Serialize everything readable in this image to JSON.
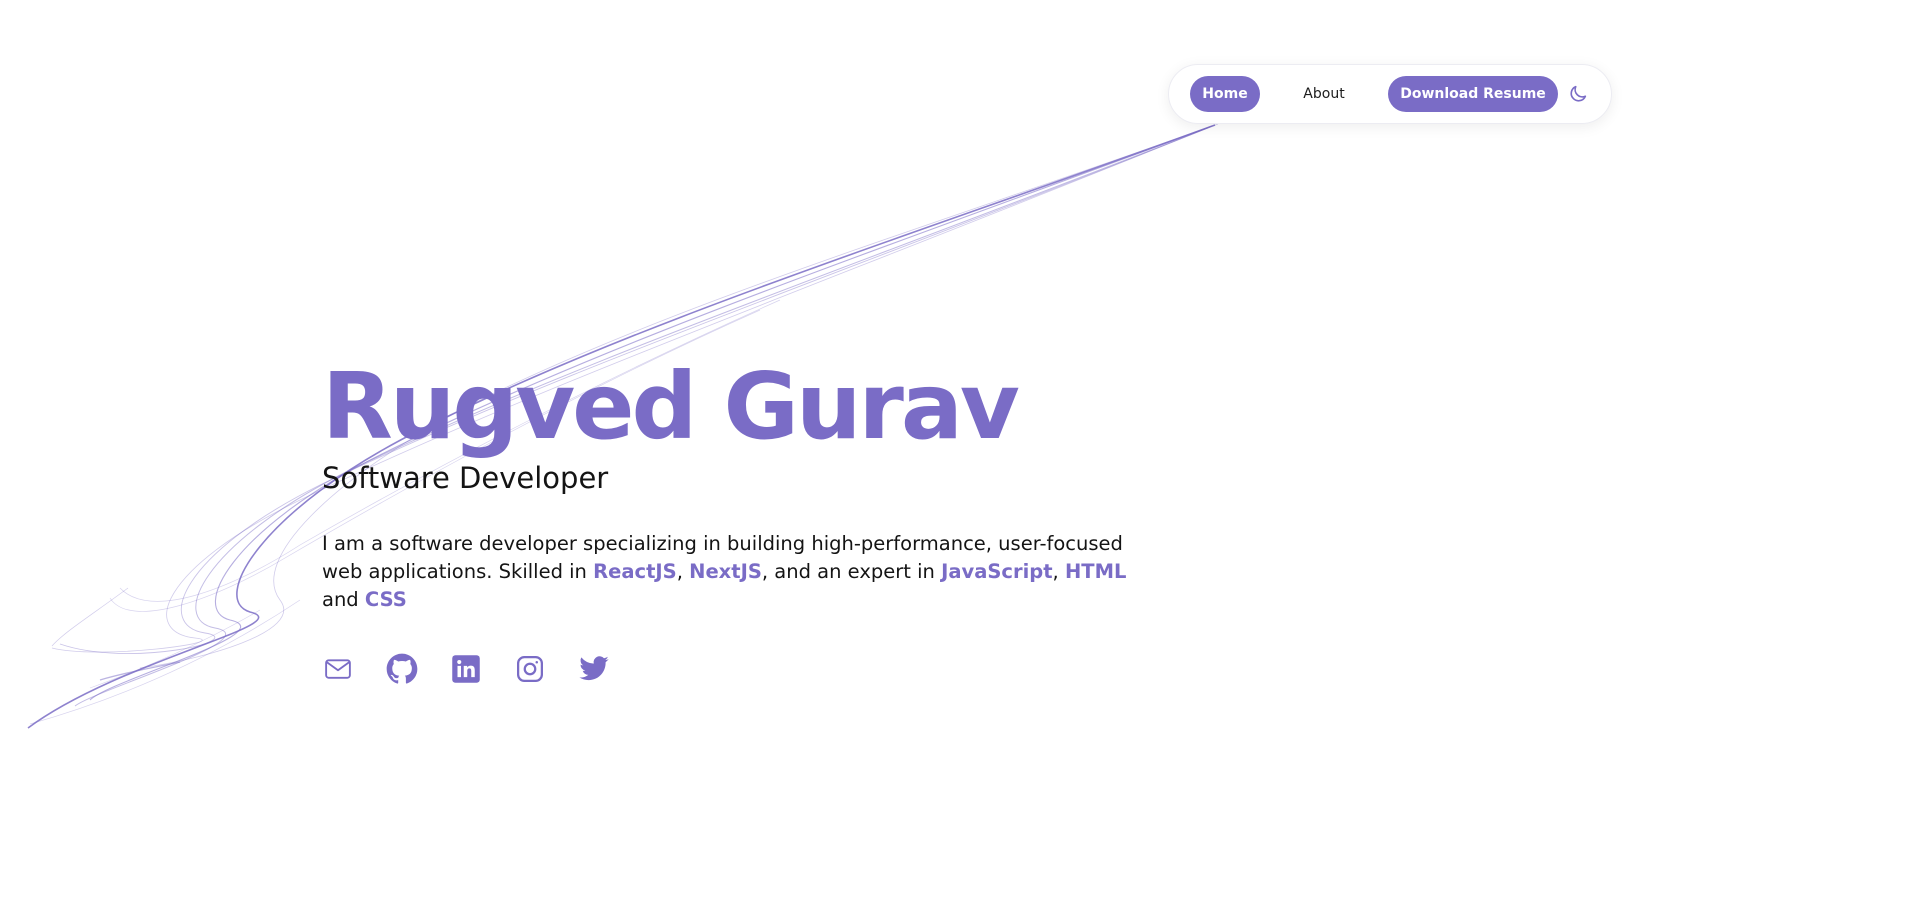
{
  "nav": {
    "home_label": "Home",
    "about_label": "About",
    "resume_label": "Download Resume",
    "theme_icon": "moon-icon"
  },
  "hero": {
    "name": "Rugved Gurav",
    "role": "Software Developer",
    "intro_1": "I am a software developer specializing in building high-performance, user-focused web applications. Skilled in ",
    "skill_react": "ReactJS",
    "sep_1": ", ",
    "skill_next": "NextJS",
    "intro_2": ", and an expert in ",
    "skill_js": "JavaScript",
    "sep_2": ", ",
    "skill_html": "HTML",
    "sep_3": " and ",
    "skill_css": "CSS"
  },
  "socials": [
    {
      "icon": "mail-icon"
    },
    {
      "icon": "github-icon"
    },
    {
      "icon": "linkedin-icon"
    },
    {
      "icon": "instagram-icon"
    },
    {
      "icon": "twitter-icon"
    }
  ],
  "colors": {
    "accent": "#7a6cc6",
    "text": "#141414",
    "background": "#ffffff"
  }
}
